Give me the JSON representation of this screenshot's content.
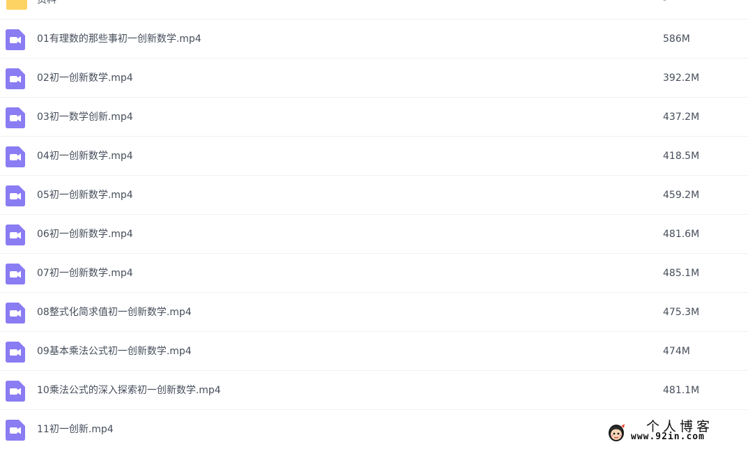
{
  "colors": {
    "folder": "#fcca4d",
    "video_icon": "#8a7cf2",
    "text": "#454d5a",
    "divider": "#f0f1f4"
  },
  "files": [
    {
      "name": "资料",
      "size": "-",
      "icon": "folder-icon"
    },
    {
      "name": "01有理数的那些事初一创新数学.mp4",
      "size": "586M",
      "icon": "video-file-icon"
    },
    {
      "name": "02初一创新数学.mp4",
      "size": "392.2M",
      "icon": "video-file-icon"
    },
    {
      "name": "03初一数学创新.mp4",
      "size": "437.2M",
      "icon": "video-file-icon"
    },
    {
      "name": "04初一创新数学.mp4",
      "size": "418.5M",
      "icon": "video-file-icon"
    },
    {
      "name": "05初一创新数学.mp4",
      "size": "459.2M",
      "icon": "video-file-icon"
    },
    {
      "name": "06初一创新数学.mp4",
      "size": "481.6M",
      "icon": "video-file-icon"
    },
    {
      "name": "07初一创新数学.mp4",
      "size": "485.1M",
      "icon": "video-file-icon"
    },
    {
      "name": "08整式化简求值初一创新数学.mp4",
      "size": "475.3M",
      "icon": "video-file-icon"
    },
    {
      "name": "09基本乘法公式初一创新数学.mp4",
      "size": "474M",
      "icon": "video-file-icon"
    },
    {
      "name": "10乘法公式的深入探索初一创新数学.mp4",
      "size": "481.1M",
      "icon": "video-file-icon"
    },
    {
      "name": "11初一创新.mp4",
      "size": "",
      "icon": "video-file-icon"
    }
  ],
  "watermark": {
    "title": "个人博客",
    "url": "www.92in.com"
  }
}
